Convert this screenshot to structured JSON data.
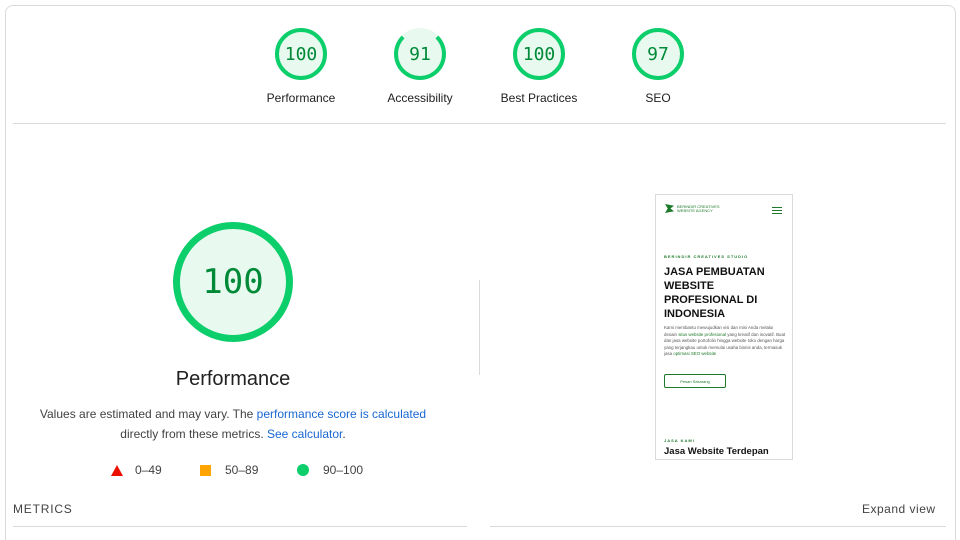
{
  "categories": [
    {
      "score": "100",
      "label": "Performance"
    },
    {
      "score": "91",
      "label": "Accessibility"
    },
    {
      "score": "100",
      "label": "Best Practices"
    },
    {
      "score": "97",
      "label": "SEO"
    }
  ],
  "main": {
    "score": "100",
    "title": "Performance",
    "desc_1": "Values are estimated and may vary. The ",
    "desc_link_1": "performance score is calculated",
    "desc_2": "directly from these metrics. ",
    "desc_link_2": "See calculator",
    "desc_3": "."
  },
  "legend": {
    "fail": "0–49",
    "average": "50–89",
    "pass": "90–100"
  },
  "screenshot": {
    "logo_line1": "BERINDIR CREATIVES",
    "logo_line2": "WEBSITE AGENCY",
    "eyebrow": "BERINDIR CREATIVES STUDIO",
    "headline": "JASA PEMBUATAN WEBSITE PROFESIONAL DI INDONESIA",
    "body_1": "Kami membantu mewujudkan visi dan misi Anda melalui desain",
    "body_link_1": "situs website profesional",
    "body_2": "yang kreatif dan inovatif. Buat dan jasa website portofolio hingga website toko dengan harga yang terjangkau untuk memulai usaha bisnis anda, termasuk jasa",
    "body_link_2": "optimasi SEO website",
    "button": "Pesan Sekarang",
    "eyebrow_2": "JASA KAMI",
    "subheading": "Jasa Website Terdepan"
  },
  "footer": {
    "metrics": "METRICS",
    "expand": "Expand view"
  },
  "colors": {
    "pass": "#0cce6b",
    "pass_text": "#008a38",
    "average": "#ffa400",
    "fail": "#eb0f00",
    "link": "#1967d2"
  }
}
